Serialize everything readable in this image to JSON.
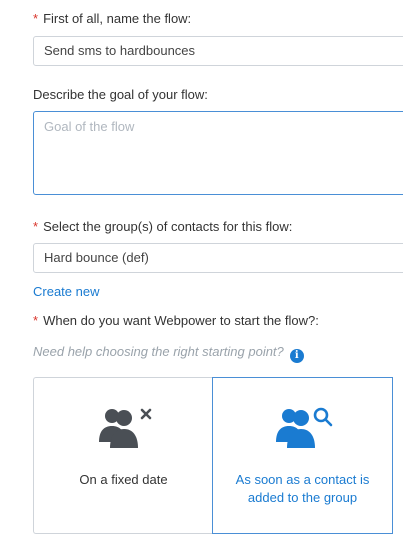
{
  "form": {
    "name_label": "First of all, name the flow:",
    "name_value": "Send sms to hardbounces",
    "goal_label": "Describe the goal of your flow:",
    "goal_placeholder": "Goal of the flow",
    "groups_label": "Select the group(s) of contacts for this flow:",
    "groups_value": "Hard bounce (def)",
    "create_new_link": "Create new",
    "start_label": "When do you want Webpower to start the flow?:",
    "help_text": "Need help choosing the right starting point?",
    "required_marker": "*"
  },
  "start_options": [
    {
      "label": "On a fixed date",
      "icon": "group-remove-icon",
      "selected": false
    },
    {
      "label": "As soon as a contact is added to the group",
      "icon": "group-search-icon",
      "selected": true
    }
  ],
  "colors": {
    "accent": "#1a7bd1",
    "required": "#d9342b",
    "icon_inactive": "#4a4f55"
  }
}
